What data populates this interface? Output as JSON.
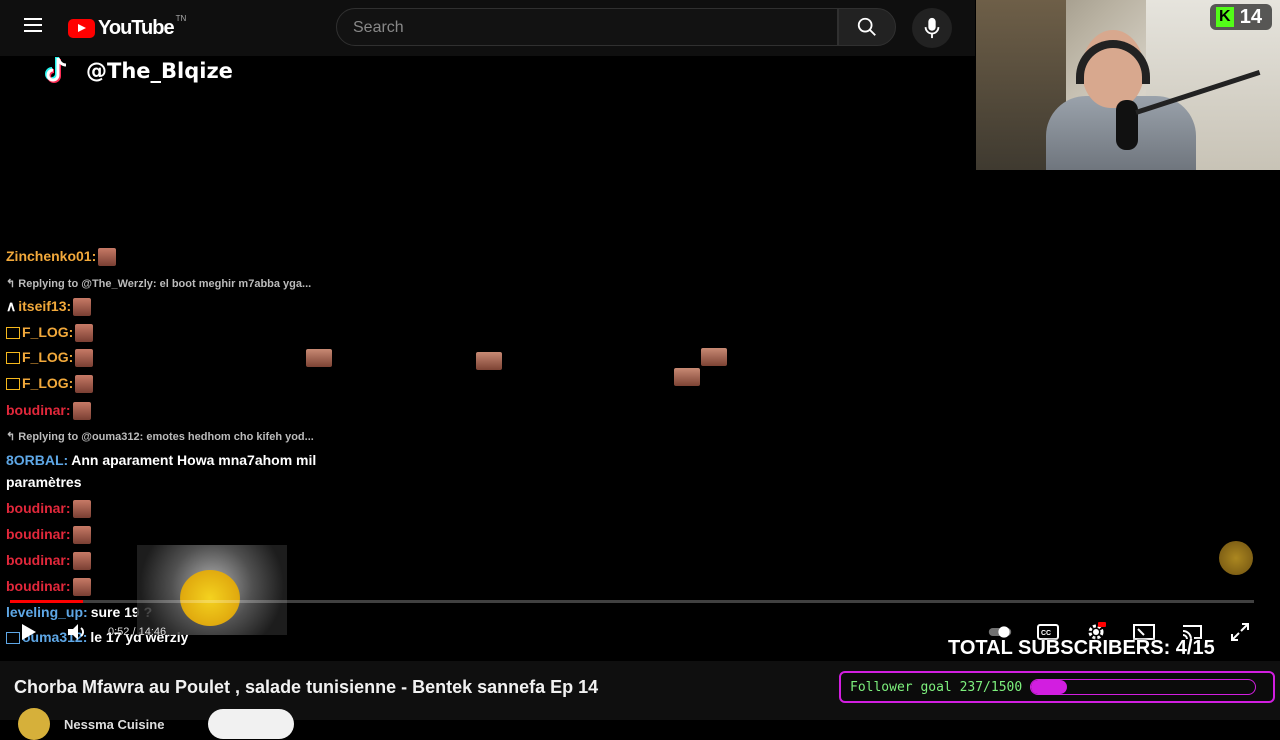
{
  "header": {
    "logo_text": "YouTube",
    "logo_sup": "TN",
    "search_placeholder": "Search"
  },
  "overlay": {
    "tiktok_handle": "@The_Blqize",
    "kick_viewers": "14",
    "total_subscribers": "TOTAL SUBSCRIBERS: 4/15"
  },
  "chat": [
    {
      "type": "msg",
      "user": "Zinchenko01:",
      "color": "orange",
      "text": "",
      "emote": true
    },
    {
      "type": "reply",
      "text": "↰ Replying to @The_Werzly: el boot meghir m7abba yga..."
    },
    {
      "type": "msg",
      "user": "itseif13:",
      "color": "orange",
      "text": "",
      "emote": true,
      "badge": "mod"
    },
    {
      "type": "msg",
      "user": "F_LOG:",
      "color": "orange",
      "text": "",
      "emote": true,
      "badge": "crown"
    },
    {
      "type": "msg",
      "user": "F_LOG:",
      "color": "orange",
      "text": "",
      "emote": true,
      "badge": "crown"
    },
    {
      "type": "msg",
      "user": "F_LOG:",
      "color": "orange",
      "text": "",
      "emote": true,
      "badge": "crown"
    },
    {
      "type": "msg",
      "user": "boudinar:",
      "color": "red",
      "text": "",
      "emote": true
    },
    {
      "type": "reply",
      "text": "↰ Replying to @ouma312: emotes hedhom cho kifeh yod..."
    },
    {
      "type": "msg",
      "user": "8ORBAL:",
      "color": "blue",
      "text": "Ann aparament Howa mna7ahom mil",
      "emote": false
    },
    {
      "type": "cont",
      "text": "paramètres"
    },
    {
      "type": "msg",
      "user": "boudinar:",
      "color": "red",
      "text": "",
      "emote": true
    },
    {
      "type": "msg",
      "user": "boudinar:",
      "color": "red",
      "text": "",
      "emote": true
    },
    {
      "type": "msg",
      "user": "boudinar:",
      "color": "red",
      "text": "",
      "emote": true
    },
    {
      "type": "msg",
      "user": "boudinar:",
      "color": "red",
      "text": "",
      "emote": true
    },
    {
      "type": "msg",
      "user": "leveling_up:",
      "color": "blue",
      "text": "sure 19 ?",
      "emote": false
    },
    {
      "type": "msg",
      "user": "ouma312:",
      "color": "blue",
      "text": "le 17 yd werzly",
      "emote": false,
      "badge": "sub"
    }
  ],
  "player": {
    "time": "0:52 / 14:46",
    "progress_fraction": 0.059
  },
  "video": {
    "title": "Chorba Mfawra au Poulet , salade tunisienne - Bentek sannefa Ep 14",
    "channel": "Nessma Cuisine"
  },
  "goal": {
    "label": "Follower goal 237/1500",
    "current": 237,
    "target": 1500,
    "fill_color": "#d21ee0",
    "text_color": "#7df07d"
  },
  "colors": {
    "progress": "#ff0000",
    "kick_green": "#53fc18"
  }
}
